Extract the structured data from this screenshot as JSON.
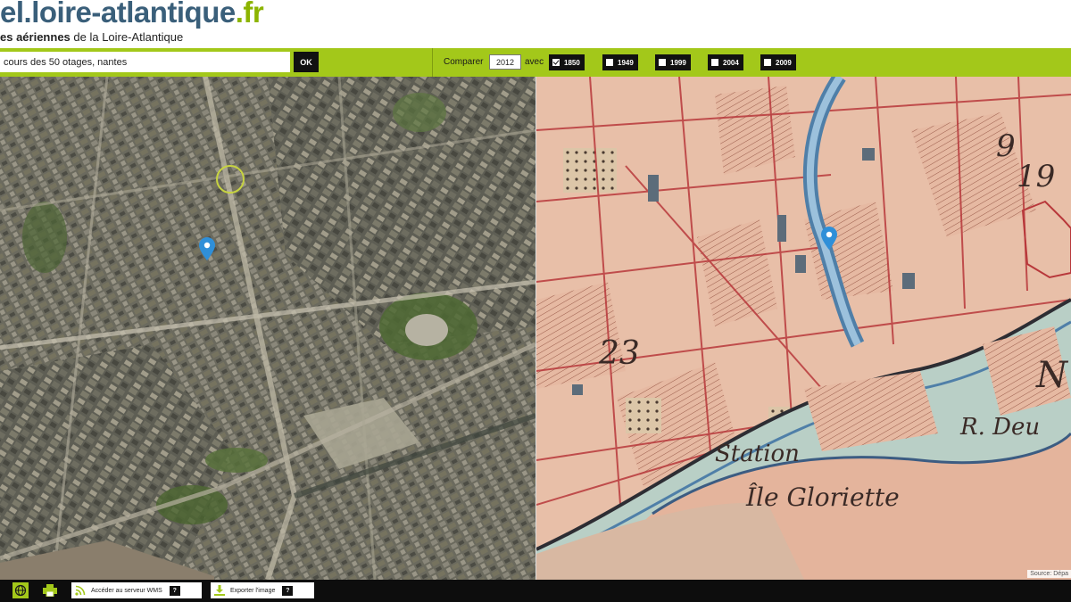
{
  "header": {
    "logo_prefix": "el.",
    "logo_main": "loire-atlantique",
    "logo_tld": ".fr",
    "subtitle_bold": "es aériennes",
    "subtitle_rest": " de la Loire-Atlantique"
  },
  "toolbar": {
    "search_value": "cours des 50 otages, nantes",
    "ok_label": "OK",
    "compare_label": "Comparer",
    "compare_year": "2012",
    "avec_label": "avec",
    "years": [
      {
        "label": "1850",
        "checked": true
      },
      {
        "label": "1949",
        "checked": false
      },
      {
        "label": "1999",
        "checked": false
      },
      {
        "label": "2004",
        "checked": false
      },
      {
        "label": "2009",
        "checked": false
      }
    ]
  },
  "map_right": {
    "label_number": "23",
    "label_station": "Station",
    "label_gloriette": "Île Gloriette",
    "label_d": "R. Deu",
    "label_19": "19",
    "label_9": "9",
    "label_n": "N",
    "attribution": "Source: Dépa"
  },
  "footer": {
    "wms_label": "Accéder au serveur WMS",
    "export_label": "Exporter l'image",
    "help_glyph": "?"
  },
  "colors": {
    "accent_green": "#a3c81a",
    "logo_blue": "#3a5f7a",
    "marker_blue": "#2f8fd8"
  },
  "icons": [
    "globe-icon",
    "print-icon",
    "rss-icon",
    "download-icon",
    "location-marker-icon"
  ]
}
